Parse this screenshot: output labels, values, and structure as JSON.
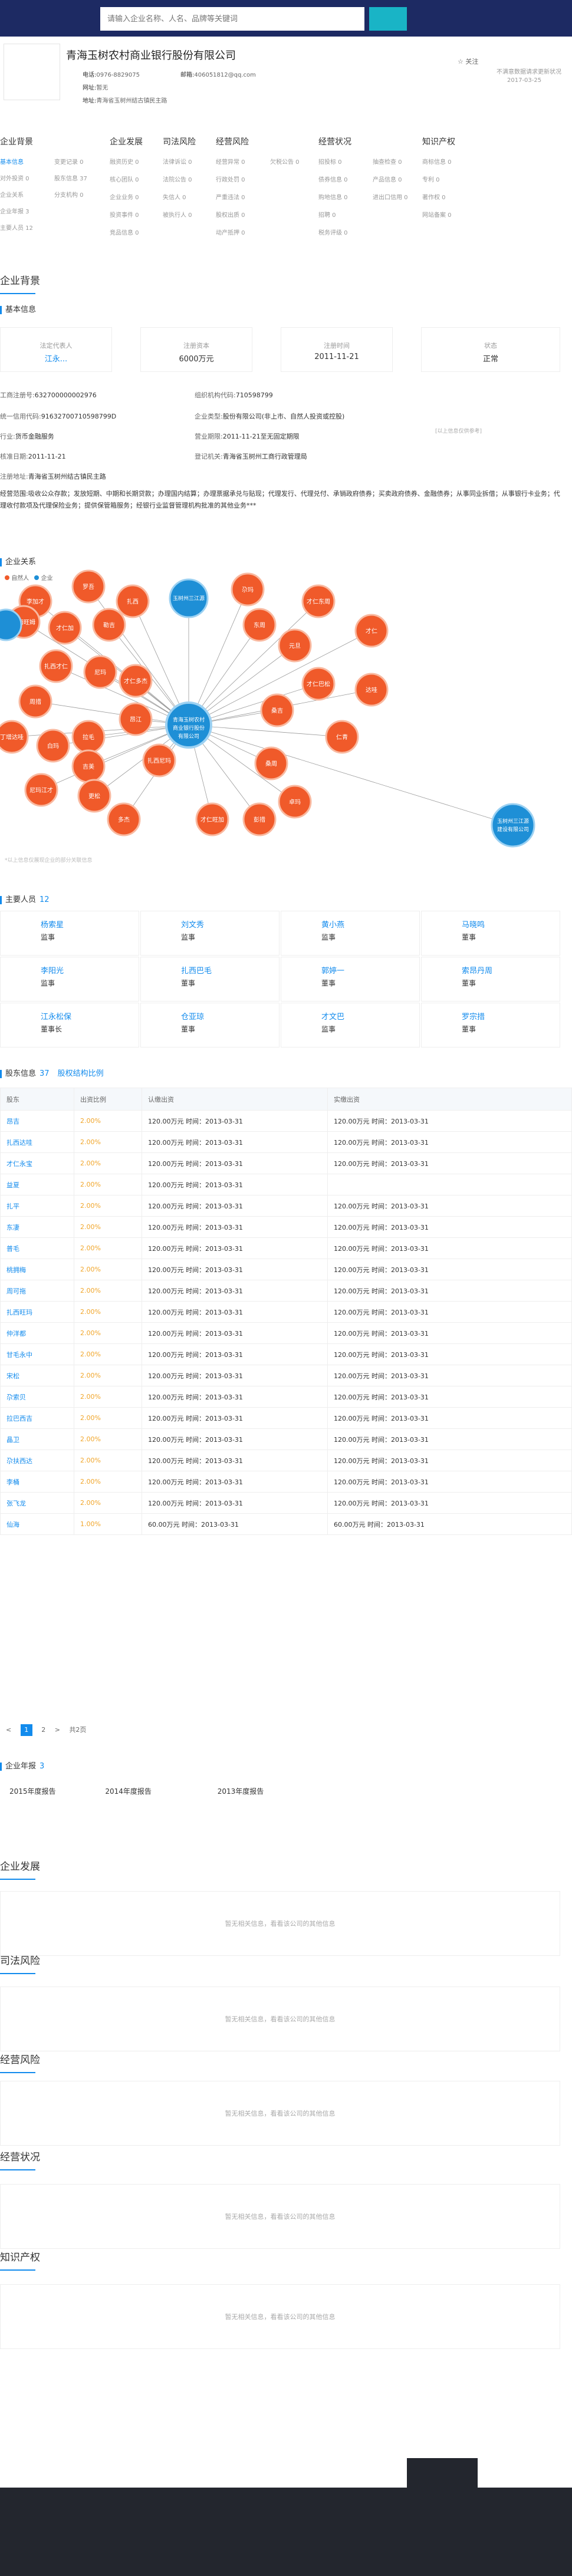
{
  "search": {
    "placeholder": "请输入企业名称、人名、品牌等关键词"
  },
  "company": {
    "name": "青海玉树农村商业银行股份有限公司",
    "phone_label": "电话:",
    "phone": "0976-8829075",
    "email_label": "邮箱:",
    "email": "406051812@qq.com",
    "website_label": "网址:",
    "website": "暂无",
    "address_label": "地址:",
    "address": "青海省玉树州结古镇民主路",
    "follow": "关注",
    "update_line1": "不满意数据请求更新状况",
    "update_line2": "2017-03-25"
  },
  "nav": [
    {
      "title": "企业背景",
      "items": [
        {
          "label": "基本信息",
          "active": true
        },
        {
          "label": "对外投资 0"
        },
        {
          "label": "企业关系"
        },
        {
          "label": "企业年报 3"
        },
        {
          "label": "主要人员 12"
        },
        {
          "label": "变更记录 0"
        },
        {
          "label": "股东信息 37"
        },
        {
          "label": "分支机构 0"
        }
      ]
    },
    {
      "title": "企业发展",
      "items": [
        {
          "label": "融资历史 0"
        },
        {
          "label": "核心团队 0"
        },
        {
          "label": "企业业务 0"
        },
        {
          "label": "投资事件 0"
        },
        {
          "label": "竞品信息 0"
        }
      ]
    },
    {
      "title": "司法风险",
      "items": [
        {
          "label": "法律诉讼 0"
        },
        {
          "label": "法院公告 0"
        },
        {
          "label": "失信人 0"
        },
        {
          "label": "被执行人 0"
        }
      ]
    },
    {
      "title": "经营风险",
      "items": [
        {
          "label": "经营异常 0"
        },
        {
          "label": "行政处罚 0"
        },
        {
          "label": "严重违法 0"
        },
        {
          "label": "股权出质 0"
        },
        {
          "label": "动产抵押 0"
        },
        {
          "label": "欠税公告 0"
        }
      ]
    },
    {
      "title": "经营状况",
      "items": [
        {
          "label": "招投标 0"
        },
        {
          "label": "债券信息 0"
        },
        {
          "label": "购地信息 0"
        },
        {
          "label": "招聘 0"
        },
        {
          "label": "税务评级 0"
        },
        {
          "label": "抽查检查 0"
        },
        {
          "label": "产品信息 0"
        },
        {
          "label": "进出口信用 0"
        }
      ]
    },
    {
      "title": "知识产权",
      "items": [
        {
          "label": "商标信息 0"
        },
        {
          "label": "专利 0"
        },
        {
          "label": "著作权 0"
        },
        {
          "label": "网站备案 0"
        }
      ]
    }
  ],
  "sections": {
    "background": "企业背景",
    "development": "企业发展",
    "legal": "司法风险",
    "operating_risk": "经营风险",
    "operating_status": "经营状况",
    "ip": "知识产权"
  },
  "basic": {
    "title": "基本信息",
    "cards": [
      {
        "label": "法定代表人",
        "value": "江永..."
      },
      {
        "label": "注册资本",
        "value": "6000万元"
      },
      {
        "label": "注册时间",
        "value": "2011-11-21"
      },
      {
        "label": "状态",
        "value": "正常"
      }
    ],
    "reg_no_label": "工商注册号:",
    "reg_no": "632700000002976",
    "org_code_label": "组织机构代码:",
    "org_code": "710598799",
    "credit_label": "统一信用代码:",
    "credit": "91632700710598799D",
    "type_label": "企业类型:",
    "type": "股份有限公司(非上市、自然人投资或控股)",
    "industry_label": "行业:",
    "industry": "货币金融服务",
    "term_label": "营业期限:",
    "term": "2011-11-21至无固定期限",
    "approve_label": "核准日期:",
    "approve": "2011-11-21",
    "authority_label": "登记机关:",
    "authority": "青海省玉树州工商行政管理局",
    "address_label": "注册地址:",
    "address": "青海省玉树州结古镇民主路",
    "note": "[以上信息仅供参考]",
    "scope_label": "经营范围:",
    "scope": "吸收公众存款；发放短期、中期和长期贷款；办理国内结算；办理票据承兑与贴现；代理发行、代理兑付、承销政府债券；买卖政府债券、金融债券；从事同业拆借；从事银行卡业务；代理收付款项及代理保险业务；提供保管箱服务；经银行业监督管理机构批准的其他业务***"
  },
  "graph": {
    "title": "企业关系",
    "legend": [
      {
        "label": "自然人",
        "color": "#f05a2a"
      },
      {
        "label": "企业",
        "color": "#1e8fd6"
      }
    ],
    "center": "青海玉树农村商业银行股份有限公司",
    "relations": [
      "股东",
      "参股"
    ],
    "note": "*以上信息仅展现企业的部分关联信息",
    "nodes": [
      "李加才",
      "罗吾",
      "扎西",
      "勒吉",
      "才仁加",
      "索南旺姆",
      "扎西才仁",
      "尼玛",
      "周措",
      "丁增达哇",
      "白玛",
      "拉毛",
      "才仁多杰",
      "昂江",
      "扎西尼玛",
      "吉美",
      "尼玛江才",
      "更松",
      "多杰",
      "才仁旺加",
      "彭措",
      "卓玛",
      "桑周",
      "桑吉",
      "才仁巴松",
      "仁青",
      "达哇",
      "元旦",
      "东周",
      "尕玛",
      "才仁东周",
      "才仁"
    ],
    "companies": [
      "青海玉树农村商业银行股份有限公司",
      "玉树州三江源民族",
      "玉树州三江源建设有限公司"
    ]
  },
  "managers": {
    "title": "主要人员",
    "count": "12",
    "list": [
      {
        "name": "杨索星",
        "position": "监事"
      },
      {
        "name": "刘文秀",
        "position": "监事"
      },
      {
        "name": "黄小燕",
        "position": "监事"
      },
      {
        "name": "马晓鸣",
        "position": "董事"
      },
      {
        "name": "李阳光",
        "position": "监事"
      },
      {
        "name": "扎西巴毛",
        "position": "董事"
      },
      {
        "name": "郭婷一",
        "position": "董事"
      },
      {
        "name": "索昂丹周",
        "position": "董事"
      },
      {
        "name": "江永松保",
        "position": "董事长"
      },
      {
        "name": "仓亚琼",
        "position": "董事"
      },
      {
        "name": "才文巴",
        "position": "监事"
      },
      {
        "name": "罗宗措",
        "position": "董事"
      }
    ]
  },
  "shareholders": {
    "title": "股东信息",
    "count": "37",
    "link": "股权结构比例",
    "headers": [
      "股东",
      "出资比例",
      "认缴出资",
      "实缴出资"
    ],
    "rows": [
      [
        "昂吉",
        "2.00%",
        "120.00万元 时间：2013-03-31",
        "120.00万元 时间：2013-03-31"
      ],
      [
        "扎西达哇",
        "2.00%",
        "120.00万元 时间：2013-03-31",
        "120.00万元 时间：2013-03-31"
      ],
      [
        "才仁永宝",
        "2.00%",
        "120.00万元 时间：2013-03-31",
        "120.00万元 时间：2013-03-31"
      ],
      [
        "益夏",
        "2.00%",
        "120.00万元 时间：2013-03-31",
        ""
      ],
      [
        "扎平",
        "2.00%",
        "120.00万元 时间：2013-03-31",
        "120.00万元 时间：2013-03-31"
      ],
      [
        "东凄",
        "2.00%",
        "120.00万元 时间：2013-03-31",
        "120.00万元 时间：2013-03-31"
      ],
      [
        "普毛",
        "2.00%",
        "120.00万元 时间：2013-03-31",
        "120.00万元 时间：2013-03-31"
      ],
      [
        "桃拥梅",
        "2.00%",
        "120.00万元 时间：2013-03-31",
        "120.00万元 时间：2013-03-31"
      ],
      [
        "周可拖",
        "2.00%",
        "120.00万元 时间：2013-03-31",
        "120.00万元 时间：2013-03-31"
      ],
      [
        "扎西旺玛",
        "2.00%",
        "120.00万元 时间：2013-03-31",
        "120.00万元 时间：2013-03-31"
      ],
      [
        "仲洋都",
        "2.00%",
        "120.00万元 时间：2013-03-31",
        "120.00万元 时间：2013-03-31"
      ],
      [
        "甘毛永中",
        "2.00%",
        "120.00万元 时间：2013-03-31",
        "120.00万元 时间：2013-03-31"
      ],
      [
        "宋松",
        "2.00%",
        "120.00万元 时间：2013-03-31",
        "120.00万元 时间：2013-03-31"
      ],
      [
        "尕索贝",
        "2.00%",
        "120.00万元 时间：2013-03-31",
        "120.00万元 时间：2013-03-31"
      ],
      [
        "拉巴西吉",
        "2.00%",
        "120.00万元 时间：2013-03-31",
        "120.00万元 时间：2013-03-31"
      ],
      [
        "晶卫",
        "2.00%",
        "120.00万元 时间：2013-03-31",
        "120.00万元 时间：2013-03-31"
      ],
      [
        "尕扶西达",
        "2.00%",
        "120.00万元 时间：2013-03-31",
        "120.00万元 时间：2013-03-31"
      ],
      [
        "李桶",
        "2.00%",
        "120.00万元 时间：2013-03-31",
        "120.00万元 时间：2013-03-31"
      ],
      [
        "张飞龙",
        "2.00%",
        "120.00万元 时间：2013-03-31",
        "120.00万元 时间：2013-03-31"
      ],
      [
        "仙海",
        "1.00%",
        "60.00万元 时间：2013-03-31",
        "60.00万元 时间：2013-03-31"
      ]
    ]
  },
  "pager": {
    "prev": "<",
    "pages": [
      "1",
      "2"
    ],
    "next": ">",
    "total": "共2页"
  },
  "annual": {
    "title": "企业年报",
    "count": "3",
    "reports": [
      "2015年度报告",
      "2014年度报告",
      "2013年度报告"
    ]
  },
  "empty_text": "暂无相关信息，看看该公司的其他信息"
}
